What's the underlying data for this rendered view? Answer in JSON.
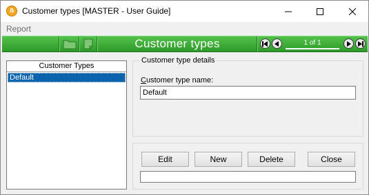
{
  "window": {
    "title": "Customer types [MASTER - User Guide]",
    "icon_letter": "a"
  },
  "menu": {
    "items": [
      "Report"
    ]
  },
  "toolbar": {
    "title": "Customer types",
    "page_indicator": "1 of 1",
    "accent_color": "#3aa834"
  },
  "list": {
    "header": "Customer Types",
    "items": [
      "Default"
    ],
    "selected_index": 0
  },
  "details": {
    "group_title": "Customer type details",
    "field_label_prefix": "C",
    "field_label_rest": "ustomer type name:",
    "field_value": "Default"
  },
  "buttons": {
    "edit": "Edit",
    "new": "New",
    "delete": "Delete",
    "close": "Close"
  },
  "status": {
    "text": ""
  }
}
